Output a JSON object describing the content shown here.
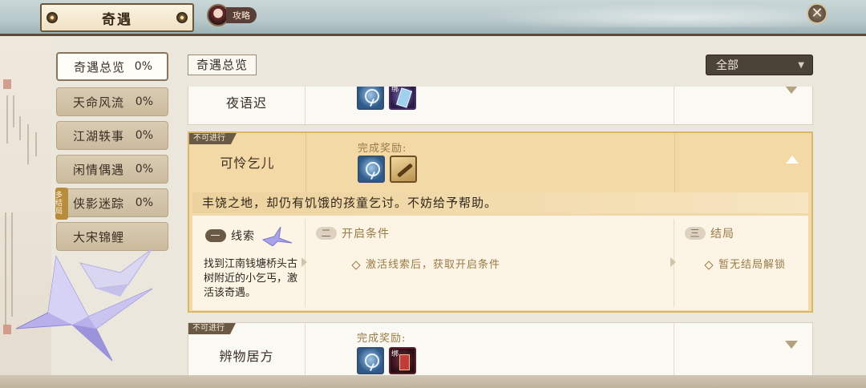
{
  "window": {
    "title": "奇遇",
    "guide_label": "攻略"
  },
  "menu": [
    {
      "label": "奇遇总览",
      "pct": "0%",
      "active": true
    },
    {
      "label": "天命风流",
      "pct": "0%"
    },
    {
      "label": "江湖轶事",
      "pct": "0%"
    },
    {
      "label": "闲情偶遇",
      "pct": "0%"
    },
    {
      "label": "侠影迷踪",
      "pct": "0%",
      "badge": "多结局"
    },
    {
      "label": "大宋锦鲤",
      "pct": ""
    }
  ],
  "header": {
    "section_title": "奇遇总览",
    "filter": "全部"
  },
  "cards": [
    {
      "name": "夜语迟"
    },
    {
      "tag": "不可进行",
      "name": "可怜乞儿",
      "reward_label": "完成奖励:",
      "description": "丰饶之地，却仍有饥饿的孩童乞讨。不妨给予帮助。",
      "steps": [
        {
          "num": "一",
          "title": "线索",
          "text": "找到江南钱塘桥头古树附近的小乞丐，激活该奇遇。"
        },
        {
          "num": "二",
          "title": "开启条件",
          "text": "激活线索后，获取开启条件"
        },
        {
          "num": "三",
          "title": "结局",
          "text": "暂无结局解锁"
        }
      ]
    },
    {
      "tag": "不可进行",
      "name": "辨物居方",
      "reward_label": "完成奖励:"
    }
  ],
  "icons": {
    "bind_text": "绑"
  }
}
